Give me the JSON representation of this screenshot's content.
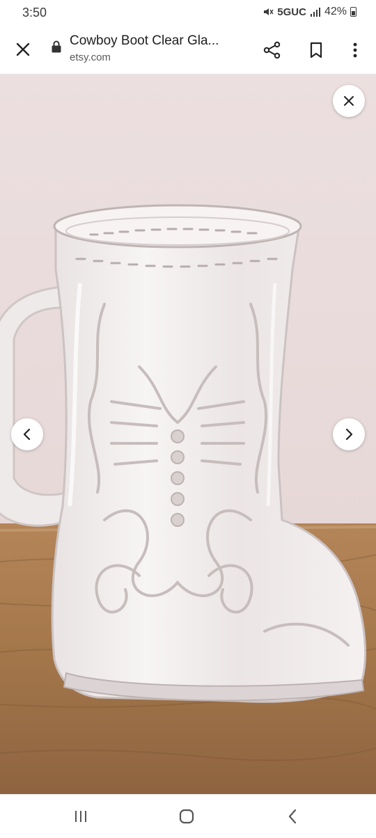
{
  "status_bar": {
    "time": "3:50",
    "network": "5GUC",
    "battery": "42%"
  },
  "browser": {
    "page_title": "Cowboy Boot Clear Gla...",
    "url": "etsy.com"
  },
  "image_viewer": {
    "subject": "glass cowboy boot mug"
  },
  "icons": {
    "close": "close-icon",
    "lock": "lock-icon",
    "share": "share-icon",
    "bookmark": "bookmark-icon",
    "menu": "more-vert-icon",
    "viewer_close": "close-icon",
    "prev": "chevron-left-icon",
    "next": "chevron-right-icon",
    "nav_recents": "recents-icon",
    "nav_home": "home-icon",
    "nav_back": "back-icon"
  },
  "colors": {
    "wall": "#eadcdc",
    "wood": "#a97a4f",
    "glass": "#f2eeee"
  }
}
